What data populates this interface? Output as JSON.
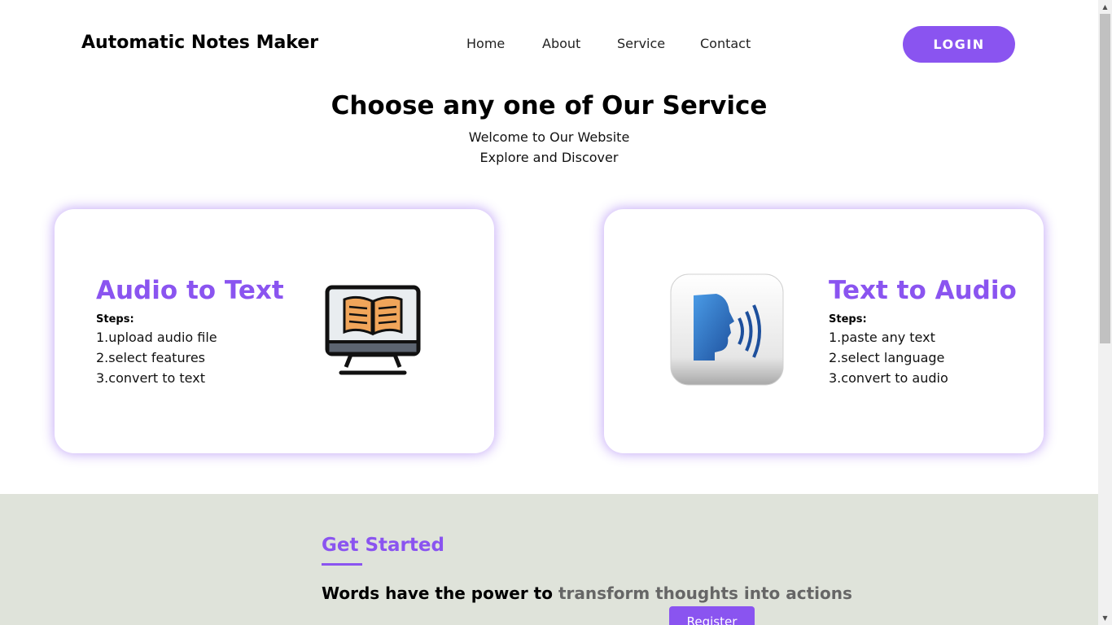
{
  "header": {
    "brand": "Automatic Notes Maker",
    "nav": [
      "Home",
      "About",
      "Service",
      "Contact"
    ],
    "login_label": "LOGIN"
  },
  "intro": {
    "title": "Choose any one of Our Service",
    "line1": "Welcome to Our Website",
    "line2": "Explore and Discover"
  },
  "cards": [
    {
      "title": "Audio to Text",
      "steps_label": "Steps:",
      "steps": [
        "1.upload audio file",
        "2.select features",
        "3.convert to text"
      ],
      "icon": "monitor-book-icon"
    },
    {
      "title": "Text to Audio",
      "steps_label": "Steps:",
      "steps": [
        "1.paste any text",
        "2.select language",
        "3.convert to audio"
      ],
      "icon": "speaking-head-icon"
    }
  ],
  "get_started": {
    "title": "Get Started",
    "text_plain": "Words have the power to ",
    "text_highlight": "transform thoughts into actions",
    "register_label": "Register"
  },
  "colors": {
    "accent": "#8a54f0",
    "band": "#dfe3da"
  }
}
